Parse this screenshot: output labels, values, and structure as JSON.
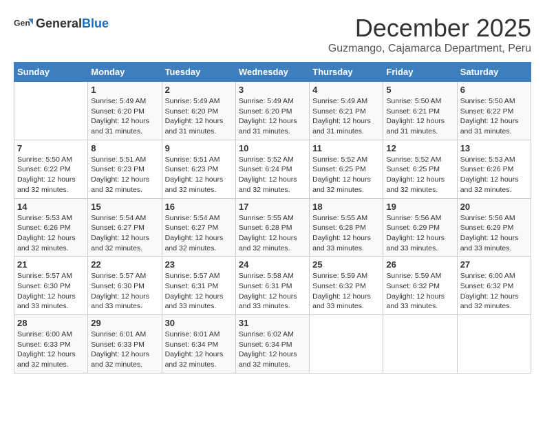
{
  "header": {
    "logo_general": "General",
    "logo_blue": "Blue",
    "month": "December 2025",
    "location": "Guzmango, Cajamarca Department, Peru"
  },
  "calendar": {
    "weekdays": [
      "Sunday",
      "Monday",
      "Tuesday",
      "Wednesday",
      "Thursday",
      "Friday",
      "Saturday"
    ],
    "weeks": [
      [
        {
          "day": "",
          "sunrise": "",
          "sunset": "",
          "daylight": ""
        },
        {
          "day": "1",
          "sunrise": "Sunrise: 5:49 AM",
          "sunset": "Sunset: 6:20 PM",
          "daylight": "Daylight: 12 hours and 31 minutes."
        },
        {
          "day": "2",
          "sunrise": "Sunrise: 5:49 AM",
          "sunset": "Sunset: 6:20 PM",
          "daylight": "Daylight: 12 hours and 31 minutes."
        },
        {
          "day": "3",
          "sunrise": "Sunrise: 5:49 AM",
          "sunset": "Sunset: 6:20 PM",
          "daylight": "Daylight: 12 hours and 31 minutes."
        },
        {
          "day": "4",
          "sunrise": "Sunrise: 5:49 AM",
          "sunset": "Sunset: 6:21 PM",
          "daylight": "Daylight: 12 hours and 31 minutes."
        },
        {
          "day": "5",
          "sunrise": "Sunrise: 5:50 AM",
          "sunset": "Sunset: 6:21 PM",
          "daylight": "Daylight: 12 hours and 31 minutes."
        },
        {
          "day": "6",
          "sunrise": "Sunrise: 5:50 AM",
          "sunset": "Sunset: 6:22 PM",
          "daylight": "Daylight: 12 hours and 31 minutes."
        }
      ],
      [
        {
          "day": "7",
          "sunrise": "Sunrise: 5:50 AM",
          "sunset": "Sunset: 6:22 PM",
          "daylight": "Daylight: 12 hours and 32 minutes."
        },
        {
          "day": "8",
          "sunrise": "Sunrise: 5:51 AM",
          "sunset": "Sunset: 6:23 PM",
          "daylight": "Daylight: 12 hours and 32 minutes."
        },
        {
          "day": "9",
          "sunrise": "Sunrise: 5:51 AM",
          "sunset": "Sunset: 6:23 PM",
          "daylight": "Daylight: 12 hours and 32 minutes."
        },
        {
          "day": "10",
          "sunrise": "Sunrise: 5:52 AM",
          "sunset": "Sunset: 6:24 PM",
          "daylight": "Daylight: 12 hours and 32 minutes."
        },
        {
          "day": "11",
          "sunrise": "Sunrise: 5:52 AM",
          "sunset": "Sunset: 6:25 PM",
          "daylight": "Daylight: 12 hours and 32 minutes."
        },
        {
          "day": "12",
          "sunrise": "Sunrise: 5:52 AM",
          "sunset": "Sunset: 6:25 PM",
          "daylight": "Daylight: 12 hours and 32 minutes."
        },
        {
          "day": "13",
          "sunrise": "Sunrise: 5:53 AM",
          "sunset": "Sunset: 6:26 PM",
          "daylight": "Daylight: 12 hours and 32 minutes."
        }
      ],
      [
        {
          "day": "14",
          "sunrise": "Sunrise: 5:53 AM",
          "sunset": "Sunset: 6:26 PM",
          "daylight": "Daylight: 12 hours and 32 minutes."
        },
        {
          "day": "15",
          "sunrise": "Sunrise: 5:54 AM",
          "sunset": "Sunset: 6:27 PM",
          "daylight": "Daylight: 12 hours and 32 minutes."
        },
        {
          "day": "16",
          "sunrise": "Sunrise: 5:54 AM",
          "sunset": "Sunset: 6:27 PM",
          "daylight": "Daylight: 12 hours and 32 minutes."
        },
        {
          "day": "17",
          "sunrise": "Sunrise: 5:55 AM",
          "sunset": "Sunset: 6:28 PM",
          "daylight": "Daylight: 12 hours and 32 minutes."
        },
        {
          "day": "18",
          "sunrise": "Sunrise: 5:55 AM",
          "sunset": "Sunset: 6:28 PM",
          "daylight": "Daylight: 12 hours and 33 minutes."
        },
        {
          "day": "19",
          "sunrise": "Sunrise: 5:56 AM",
          "sunset": "Sunset: 6:29 PM",
          "daylight": "Daylight: 12 hours and 33 minutes."
        },
        {
          "day": "20",
          "sunrise": "Sunrise: 5:56 AM",
          "sunset": "Sunset: 6:29 PM",
          "daylight": "Daylight: 12 hours and 33 minutes."
        }
      ],
      [
        {
          "day": "21",
          "sunrise": "Sunrise: 5:57 AM",
          "sunset": "Sunset: 6:30 PM",
          "daylight": "Daylight: 12 hours and 33 minutes."
        },
        {
          "day": "22",
          "sunrise": "Sunrise: 5:57 AM",
          "sunset": "Sunset: 6:30 PM",
          "daylight": "Daylight: 12 hours and 33 minutes."
        },
        {
          "day": "23",
          "sunrise": "Sunrise: 5:57 AM",
          "sunset": "Sunset: 6:31 PM",
          "daylight": "Daylight: 12 hours and 33 minutes."
        },
        {
          "day": "24",
          "sunrise": "Sunrise: 5:58 AM",
          "sunset": "Sunset: 6:31 PM",
          "daylight": "Daylight: 12 hours and 33 minutes."
        },
        {
          "day": "25",
          "sunrise": "Sunrise: 5:59 AM",
          "sunset": "Sunset: 6:32 PM",
          "daylight": "Daylight: 12 hours and 33 minutes."
        },
        {
          "day": "26",
          "sunrise": "Sunrise: 5:59 AM",
          "sunset": "Sunset: 6:32 PM",
          "daylight": "Daylight: 12 hours and 33 minutes."
        },
        {
          "day": "27",
          "sunrise": "Sunrise: 6:00 AM",
          "sunset": "Sunset: 6:32 PM",
          "daylight": "Daylight: 12 hours and 32 minutes."
        }
      ],
      [
        {
          "day": "28",
          "sunrise": "Sunrise: 6:00 AM",
          "sunset": "Sunset: 6:33 PM",
          "daylight": "Daylight: 12 hours and 32 minutes."
        },
        {
          "day": "29",
          "sunrise": "Sunrise: 6:01 AM",
          "sunset": "Sunset: 6:33 PM",
          "daylight": "Daylight: 12 hours and 32 minutes."
        },
        {
          "day": "30",
          "sunrise": "Sunrise: 6:01 AM",
          "sunset": "Sunset: 6:34 PM",
          "daylight": "Daylight: 12 hours and 32 minutes."
        },
        {
          "day": "31",
          "sunrise": "Sunrise: 6:02 AM",
          "sunset": "Sunset: 6:34 PM",
          "daylight": "Daylight: 12 hours and 32 minutes."
        },
        {
          "day": "",
          "sunrise": "",
          "sunset": "",
          "daylight": ""
        },
        {
          "day": "",
          "sunrise": "",
          "sunset": "",
          "daylight": ""
        },
        {
          "day": "",
          "sunrise": "",
          "sunset": "",
          "daylight": ""
        }
      ]
    ]
  }
}
